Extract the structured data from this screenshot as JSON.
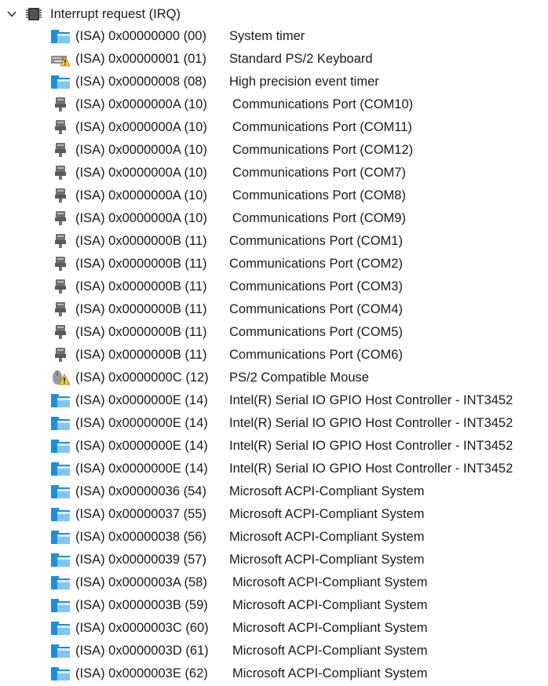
{
  "tree": {
    "root": {
      "label": "Interrupt request (IRQ)",
      "expanded": true,
      "icon": "irq-chip-icon"
    },
    "items": [
      {
        "addr": "(ISA) 0x00000000 (00)",
        "desc": "System timer",
        "icon": "system-device-icon"
      },
      {
        "addr": "(ISA) 0x00000001 (01)",
        "desc": "Standard PS/2 Keyboard",
        "icon": "keyboard-warning-icon"
      },
      {
        "addr": "(ISA) 0x00000008 (08)",
        "desc": "High precision event timer",
        "icon": "system-device-icon"
      },
      {
        "addr": "(ISA) 0x0000000A (10)",
        "desc": "Communications Port (COM10)",
        "icon": "port-connector-icon"
      },
      {
        "addr": "(ISA) 0x0000000A (10)",
        "desc": "Communications Port (COM11)",
        "icon": "port-connector-icon"
      },
      {
        "addr": "(ISA) 0x0000000A (10)",
        "desc": "Communications Port (COM12)",
        "icon": "port-connector-icon"
      },
      {
        "addr": "(ISA) 0x0000000A (10)",
        "desc": "Communications Port (COM7)",
        "icon": "port-connector-icon"
      },
      {
        "addr": "(ISA) 0x0000000A (10)",
        "desc": "Communications Port (COM8)",
        "icon": "port-connector-icon"
      },
      {
        "addr": "(ISA) 0x0000000A (10)",
        "desc": "Communications Port (COM9)",
        "icon": "port-connector-icon"
      },
      {
        "addr": "(ISA) 0x0000000B (11)",
        "desc": "Communications Port (COM1)",
        "icon": "port-connector-icon"
      },
      {
        "addr": "(ISA) 0x0000000B (11)",
        "desc": "Communications Port (COM2)",
        "icon": "port-connector-icon"
      },
      {
        "addr": "(ISA) 0x0000000B (11)",
        "desc": "Communications Port (COM3)",
        "icon": "port-connector-icon"
      },
      {
        "addr": "(ISA) 0x0000000B (11)",
        "desc": "Communications Port (COM4)",
        "icon": "port-connector-icon"
      },
      {
        "addr": "(ISA) 0x0000000B (11)",
        "desc": "Communications Port (COM5)",
        "icon": "port-connector-icon"
      },
      {
        "addr": "(ISA) 0x0000000B (11)",
        "desc": "Communications Port (COM6)",
        "icon": "port-connector-icon"
      },
      {
        "addr": "(ISA) 0x0000000C (12)",
        "desc": "PS/2 Compatible Mouse",
        "icon": "mouse-warning-icon"
      },
      {
        "addr": "(ISA) 0x0000000E (14)",
        "desc": "Intel(R) Serial IO GPIO Host Controller - INT3452",
        "icon": "system-device-icon"
      },
      {
        "addr": "(ISA) 0x0000000E (14)",
        "desc": "Intel(R) Serial IO GPIO Host Controller - INT3452",
        "icon": "system-device-icon"
      },
      {
        "addr": "(ISA) 0x0000000E (14)",
        "desc": "Intel(R) Serial IO GPIO Host Controller - INT3452",
        "icon": "system-device-icon"
      },
      {
        "addr": "(ISA) 0x0000000E (14)",
        "desc": "Intel(R) Serial IO GPIO Host Controller - INT3452",
        "icon": "system-device-icon"
      },
      {
        "addr": "(ISA) 0x00000036 (54)",
        "desc": "Microsoft ACPI-Compliant System",
        "icon": "system-device-icon"
      },
      {
        "addr": "(ISA) 0x00000037 (55)",
        "desc": "Microsoft ACPI-Compliant System",
        "icon": "system-device-icon"
      },
      {
        "addr": "(ISA) 0x00000038 (56)",
        "desc": "Microsoft ACPI-Compliant System",
        "icon": "system-device-icon"
      },
      {
        "addr": "(ISA) 0x00000039 (57)",
        "desc": "Microsoft ACPI-Compliant System",
        "icon": "system-device-icon"
      },
      {
        "addr": "(ISA) 0x0000003A (58)",
        "desc": "Microsoft ACPI-Compliant System",
        "icon": "system-device-icon"
      },
      {
        "addr": "(ISA) 0x0000003B (59)",
        "desc": "Microsoft ACPI-Compliant System",
        "icon": "system-device-icon"
      },
      {
        "addr": "(ISA) 0x0000003C (60)",
        "desc": "Microsoft ACPI-Compliant System",
        "icon": "system-device-icon"
      },
      {
        "addr": "(ISA) 0x0000003D (61)",
        "desc": "Microsoft ACPI-Compliant System",
        "icon": "system-device-icon"
      },
      {
        "addr": "(ISA) 0x0000003E (62)",
        "desc": "Microsoft ACPI-Compliant System",
        "icon": "system-device-icon"
      }
    ]
  },
  "colors": {
    "folder_blue": "#1d8fd9",
    "folder_light": "#7fc6f2",
    "folder_tab": "#d9ecf7",
    "port_gray": "#707070",
    "warning_yellow": "#f6c83d",
    "chip_dark": "#3a3a3a"
  }
}
